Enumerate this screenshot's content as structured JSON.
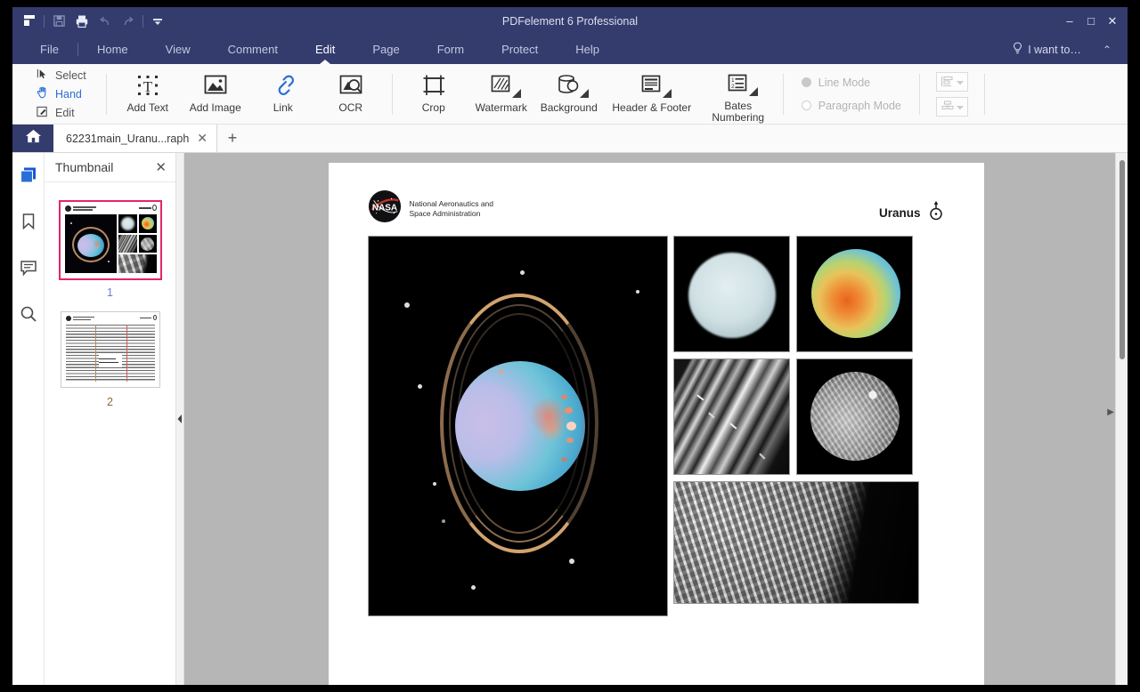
{
  "window": {
    "title": "PDFelement 6 Professional",
    "minimize": "–",
    "maximize": "□",
    "close": "✕"
  },
  "quick_access": [
    {
      "name": "app-logo-icon",
      "label": "PDFelement"
    },
    {
      "name": "save-icon",
      "label": "Save"
    },
    {
      "name": "print-icon",
      "label": "Print"
    },
    {
      "name": "undo-icon",
      "label": "Undo"
    },
    {
      "name": "redo-icon",
      "label": "Redo"
    },
    {
      "name": "customize-qat-icon",
      "label": "Customize Quick Access Toolbar"
    }
  ],
  "menu": {
    "items": [
      {
        "label": "File",
        "active": false
      },
      {
        "label": "Home",
        "active": false
      },
      {
        "label": "View",
        "active": false
      },
      {
        "label": "Comment",
        "active": false
      },
      {
        "label": "Edit",
        "active": true
      },
      {
        "label": "Page",
        "active": false
      },
      {
        "label": "Form",
        "active": false
      },
      {
        "label": "Protect",
        "active": false
      },
      {
        "label": "Help",
        "active": false
      }
    ],
    "i_want_to": "I want to…",
    "collapse": "⌃"
  },
  "ribbon": {
    "modes": [
      {
        "label": "Select",
        "selected": false
      },
      {
        "label": "Hand",
        "selected": true
      },
      {
        "label": "Edit",
        "selected": false
      }
    ],
    "tools": [
      {
        "label": "Add Text",
        "icon": "add-text-icon",
        "caret": false
      },
      {
        "label": "Add Image",
        "icon": "add-image-icon",
        "caret": false
      },
      {
        "label": "Link",
        "icon": "link-icon",
        "caret": false
      },
      {
        "label": "OCR",
        "icon": "ocr-icon",
        "caret": false
      },
      {
        "label": "Crop",
        "icon": "crop-icon",
        "caret": false
      },
      {
        "label": "Watermark",
        "icon": "watermark-icon",
        "caret": true
      },
      {
        "label": "Background",
        "icon": "background-icon",
        "caret": true
      },
      {
        "label": "Header & Footer",
        "icon": "header-footer-icon",
        "caret": true
      },
      {
        "label": "Bates Numbering",
        "icon": "bates-numbering-icon",
        "caret": true
      }
    ],
    "radios": [
      {
        "label": "Line Mode",
        "selected": true
      },
      {
        "label": "Paragraph Mode",
        "selected": false
      }
    ],
    "align_buttons": [
      {
        "name": "align-left-dropdown",
        "label": "Align"
      },
      {
        "name": "distribute-dropdown",
        "label": "Distribute"
      }
    ]
  },
  "tabs": {
    "home_icon": "home-icon",
    "documents": [
      {
        "label": "62231main_Uranu...raph",
        "close": "✕"
      }
    ],
    "new_tab": "+"
  },
  "sidebar": {
    "rail": [
      {
        "name": "sidebar-item-thumbnail",
        "label": "Thumbnail",
        "active": true
      },
      {
        "name": "sidebar-item-bookmark",
        "label": "Bookmark",
        "active": false
      },
      {
        "name": "sidebar-item-comment",
        "label": "Comment",
        "active": false
      },
      {
        "name": "sidebar-item-search",
        "label": "Search",
        "active": false
      }
    ],
    "panel": {
      "title": "Thumbnail",
      "close": "✕",
      "pages": [
        {
          "number": "1",
          "selected": true,
          "kind": "images"
        },
        {
          "number": "2",
          "selected": false,
          "kind": "text"
        }
      ]
    },
    "collapse_handle": "◀"
  },
  "document": {
    "header": {
      "agency_line1": "National Aeronautics and",
      "agency_line2": "Space Administration",
      "logo_text": "NASA",
      "planet_label": "Uranus",
      "planet_symbol": "⛢"
    },
    "images": [
      {
        "name": "uranus-rings-hubble-image",
        "alt": "Uranus with rings and moons"
      },
      {
        "name": "uranus-true-color-image",
        "alt": "Uranus pale blue disc"
      },
      {
        "name": "uranus-false-color-image",
        "alt": "Uranus false color disc"
      },
      {
        "name": "uranus-rings-closeup-image",
        "alt": "Uranus rings close-up"
      },
      {
        "name": "miranda-moon-image",
        "alt": "Moon Miranda"
      },
      {
        "name": "miranda-surface-image",
        "alt": "Miranda surface close-up"
      }
    ]
  },
  "scroll": {
    "right_handle": "▶"
  },
  "colors": {
    "titlebar": "#343c6e",
    "accent": "#2a6fd6",
    "canvas": "#b6b6b6",
    "thumb_selection": "#e2266d"
  }
}
